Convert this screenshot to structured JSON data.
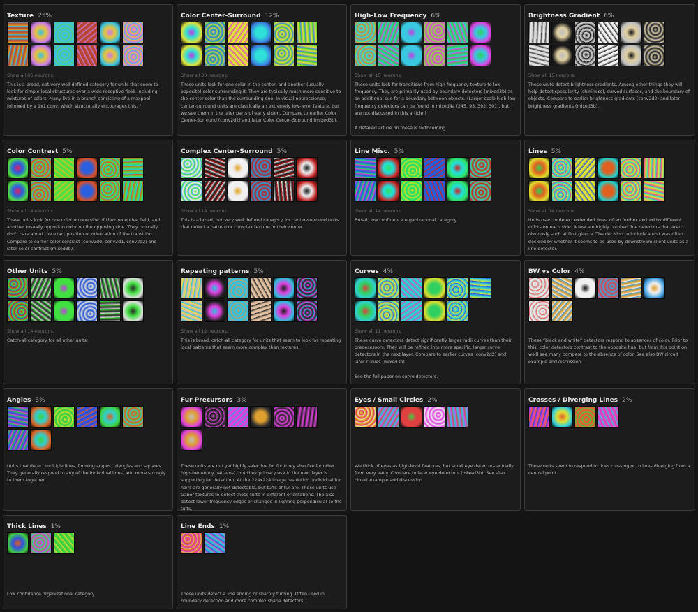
{
  "colors": {
    "background": "#141414",
    "card": "#1c1c1c",
    "border": "#3a3a3a",
    "title": "#e6e6e6",
    "muted": "#6e6e6e"
  },
  "cards": [
    {
      "title": "Texture",
      "pct": "25%",
      "show_all": "Show all 65 neurons.",
      "desc": "This is a broad, not very well defined category for units that seem to look for simple local structures over a wide receptive field, including mixtures of colors. Many live in a branch consisting of a maxpool followed by a 1x1 conv, which structurally encourages this. ⁹",
      "desc2": ""
    },
    {
      "title": "Color Center-Surround",
      "pct": "12%",
      "show_all": "Show all 30 neurons.",
      "desc": "These units look for one color in the center, and another (usually opposite) color surrounding it. They are typically much more sensitive to the center color than the surrounding one. In visual neuroscience, center-surround units are classically an extremely low-level feature, but we see them in the later parts of early vision. Compare to earlier Color Center-Surround (conv2d2) and later Color Center-Surround (mixed3b).",
      "desc2": ""
    },
    {
      "title": "High-Low Frequency",
      "pct": "6%",
      "show_all": "Show all 15 neurons.",
      "desc": "These units look for transitions from high-frequency texture to low-frequency. They are primarily used by boundary detectors (mixed3b) as an additional cue for a boundary between objects. (Larger scale high-low frequency detectors can be found in mixed4a (245, 93, 392, 301), but are not discussed in this article.)",
      "desc2": "A detailed article on these is forthcoming."
    },
    {
      "title": "Brightness Gradient",
      "pct": "6%",
      "show_all": "Show all 15 neurons.",
      "desc": "These units detect brightness gradients. Among other things they will help detect specularity (shininess), curved surfaces, and the boundary of objects. Compare to earlier brightness gradients (conv2d2) and later brightness gradients (mixed3b).",
      "desc2": ""
    },
    {
      "title": "Color Contrast",
      "pct": "5%",
      "show_all": "Show all 14 neurons.",
      "desc": "These units look for one color on one side of their receptive field, and another (usually opposite) color on the opposing side. They typically don't care about the exact position or orientation of the transition. Compare to earlier color contrast (conv2d0, conv2d1, conv2d2) and later color contrast (mixed3b).",
      "desc2": ""
    },
    {
      "title": "Complex Center-Surround",
      "pct": "5%",
      "show_all": "Show all 14 neurons.",
      "desc": "This is a broad, not very well defined category for center-surround units that detect a pattern or complex texture in their center.",
      "desc2": ""
    },
    {
      "title": "Line Misc.",
      "pct": "5%",
      "show_all": "Show all 14 neurons.",
      "desc": "Broad, low confidence organizational category.",
      "desc2": ""
    },
    {
      "title": "Lines",
      "pct": "5%",
      "show_all": "Show all 14 neurons.",
      "desc": "Units used to detect extended lines, often further excited by different colors on each side. A few are highly combed line detectors that aren't obviously such at first glance. The decision to include a unit was often decided by whether it seems to be used by downstream client units as a line detector.",
      "desc2": ""
    },
    {
      "title": "Other Units",
      "pct": "5%",
      "show_all": "Show all 14 neurons.",
      "desc": "Catch-all category for all other units.",
      "desc2": ""
    },
    {
      "title": "Repeating patterns",
      "pct": "5%",
      "show_all": "Show all 12 neurons.",
      "desc": "This is broad, catch-all category for units that seem to look for repeating local patterns that seem more complex than textures.",
      "desc2": ""
    },
    {
      "title": "Curves",
      "pct": "4%",
      "show_all": "Show all 11 neurons.",
      "desc": "These curve detectors detect significantly larger radii curves than their predecessors. They will be refined into more specific, larger curve detectors in the next layer. Compare to earlier curves (conv2d2) and later curves (mixed3b).",
      "desc2": "See the full paper on curve detectors."
    },
    {
      "title": "BW vs Color",
      "pct": "4%",
      "show_all": "",
      "desc": "These “black and white” detectors respond to absences of color. Prior to this, color detectors contrast to the opposite hue, but from this point on we'll see many compare to the absence of color. See also BW circuit example and discussion.",
      "desc2": ""
    },
    {
      "title": "Angles",
      "pct": "3%",
      "show_all": "",
      "desc": "Units that detect multiple lines, forming angles, triangles and squares. They generally respond to any of the individual lines, and more strongly to them together.",
      "desc2": ""
    },
    {
      "title": "Fur Precursors",
      "pct": "3%",
      "show_all": "",
      "desc": "These units are not yet highly selective for fur (they also fire for other high-frequency patterns), but their primary use in the next layer is supporting fur detection. At the 224x224 image resolution, individual fur hairs are generally not detectable, but tufts of fur are. These units use Gabor textures to detect those tufts in different orientations. The also detect lower frequency edges or changes in lighting perpendicular to the tufts.",
      "desc2": ""
    },
    {
      "title": "Eyes / Small Circles",
      "pct": "2%",
      "show_all": "",
      "desc": "We think of eyes as high-level features, but small eye detectors actually form very early. Compare to later eye detectors (mixed3b). See also circuit example and discussion.",
      "desc2": ""
    },
    {
      "title": "Crosses / Diverging Lines",
      "pct": "2%",
      "show_all": "",
      "desc": "These units seem to respond to lines crossing or to lines diverging from a central point.",
      "desc2": ""
    },
    {
      "title": "Thick Lines",
      "pct": "1%",
      "show_all": "",
      "desc": "Low confidence organizational category.",
      "desc2": ""
    },
    {
      "title": "Line Ends",
      "pct": "1%",
      "show_all": "",
      "desc": "These units detect a line ending or sharply turning. Often used in boundary detection and more complex shape detectors.",
      "desc2": ""
    }
  ]
}
